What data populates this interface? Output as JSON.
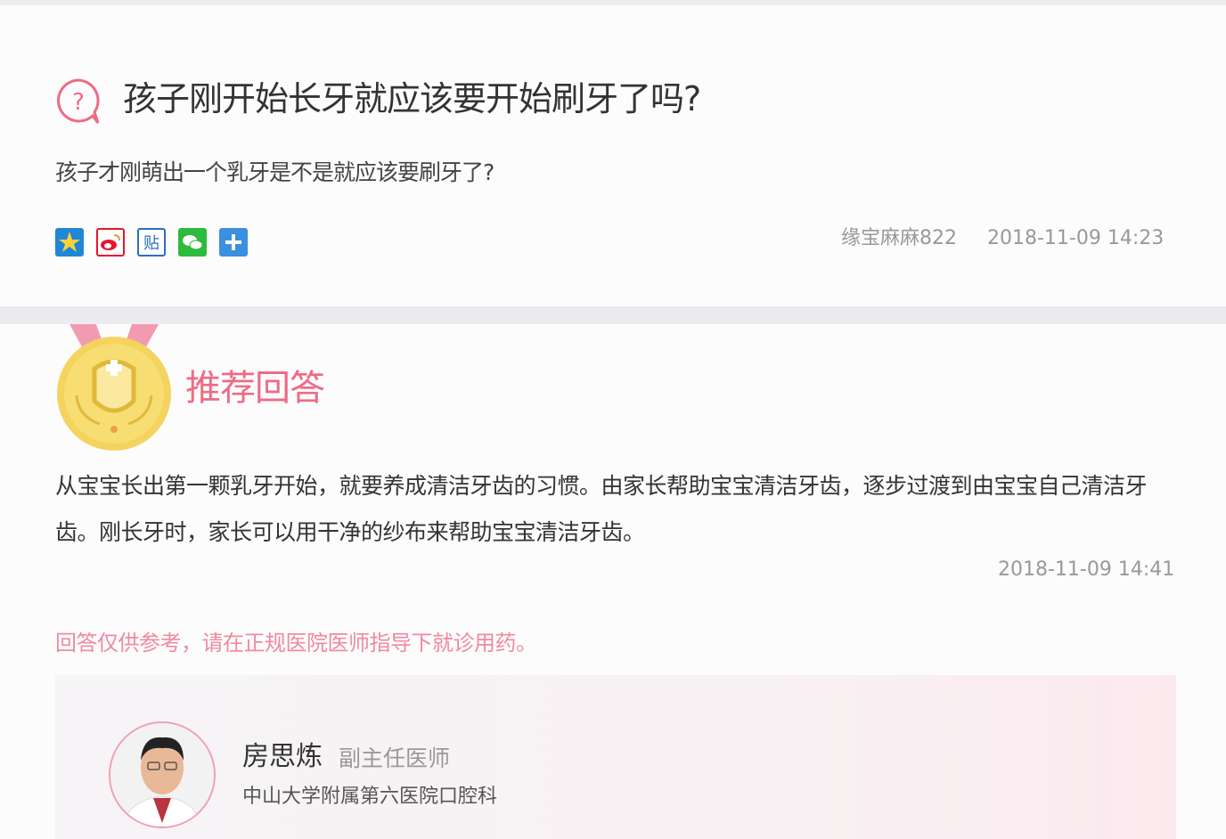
{
  "question": {
    "title": "孩子刚开始长牙就应该要开始刷牙了吗?",
    "description": "孩子才刚萌出一个乳牙是不是就应该要刷牙了?",
    "share_icons": [
      "qzone-icon",
      "weibo-icon",
      "tieba-icon",
      "wechat-icon",
      "more-share-icon"
    ],
    "share_tieba_glyph": "贴",
    "asker": "缘宝麻麻822",
    "time": "2018-11-09 14:23"
  },
  "answer": {
    "badge_title": "推荐回答",
    "content": "从宝宝长出第一颗乳牙开始，就要养成清洁牙齿的习惯。由家长帮助宝宝清洁牙齿，逐步过渡到由宝宝自己清洁牙齿。刚长牙时，家长可以用干净的纱布来帮助宝宝清洁牙齿。",
    "time": "2018-11-09 14:41",
    "disclaimer": "回答仅供参考，请在正规医院医师指导下就诊用药。"
  },
  "doctor": {
    "name": "房思炼",
    "title": "副主任医师",
    "hospital": "中山大学附属第六医院口腔科"
  },
  "colors": {
    "accent_pink": "#ee6b83",
    "gold": "#f2d25a"
  }
}
